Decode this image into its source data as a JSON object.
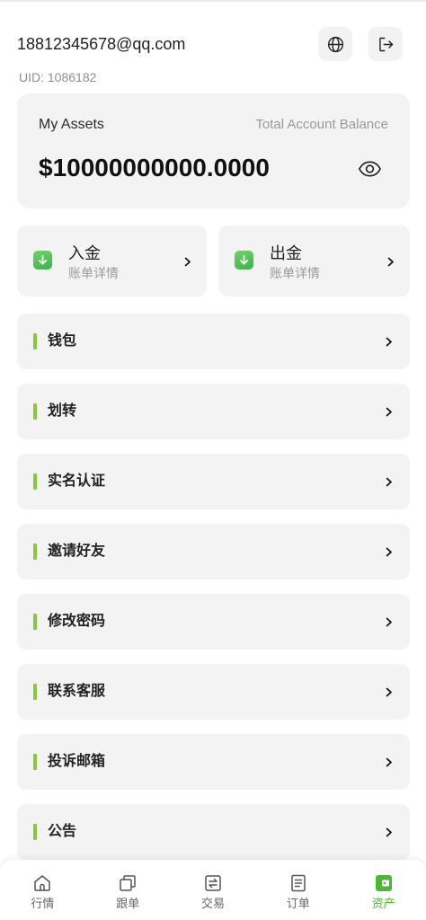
{
  "header": {
    "email": "18812345678@qq.com",
    "uid": "UID: 1086182",
    "language_icon": "globe-icon",
    "logout_icon": "logout-icon"
  },
  "assets": {
    "title": "My Assets",
    "balance_label": "Total Account Balance",
    "balance": "$10000000000.0000",
    "visibility_icon": "eye-icon"
  },
  "actions": [
    {
      "label": "入金",
      "sublabel": "账单详情",
      "icon": "down-arrow-icon"
    },
    {
      "label": "出金",
      "sublabel": "账单详情",
      "icon": "down-arrow-icon"
    }
  ],
  "menu": [
    {
      "label": "钱包"
    },
    {
      "label": "划转"
    },
    {
      "label": "实名认证"
    },
    {
      "label": "邀请好友"
    },
    {
      "label": "修改密码"
    },
    {
      "label": "联系客服"
    },
    {
      "label": "投诉邮箱"
    },
    {
      "label": "公告"
    }
  ],
  "nav": [
    {
      "label": "行情",
      "icon": "market-icon",
      "active": false
    },
    {
      "label": "跟单",
      "icon": "copy-trade-icon",
      "active": false
    },
    {
      "label": "交易",
      "icon": "exchange-icon",
      "active": false
    },
    {
      "label": "订单",
      "icon": "order-icon",
      "active": false
    },
    {
      "label": "资产",
      "icon": "wallet-icon",
      "active": true
    }
  ],
  "colors": {
    "accent": "#4fb43a",
    "menu_bar": "#8cc63f",
    "card_background": "#f3f3f3",
    "text": "#222222",
    "muted_text": "#9a9a9a"
  }
}
